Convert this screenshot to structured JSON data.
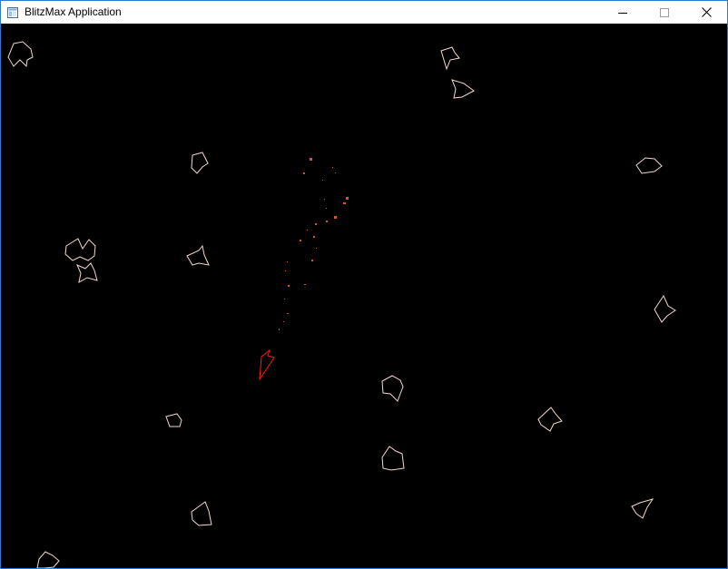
{
  "window": {
    "title": "BlitzMax Application",
    "icon": "application-window-icon",
    "controls": [
      {
        "name": "minimize-button",
        "icon": "minimize-icon"
      },
      {
        "name": "maximize-button",
        "icon": "maximize-icon"
      },
      {
        "name": "close-button",
        "icon": "close-icon"
      }
    ]
  },
  "game": {
    "background_color": "#000000",
    "asteroid_color": "#f4d8d0",
    "ship_color": "#ff1a1a",
    "particle_color": "#e0561a"
  }
}
